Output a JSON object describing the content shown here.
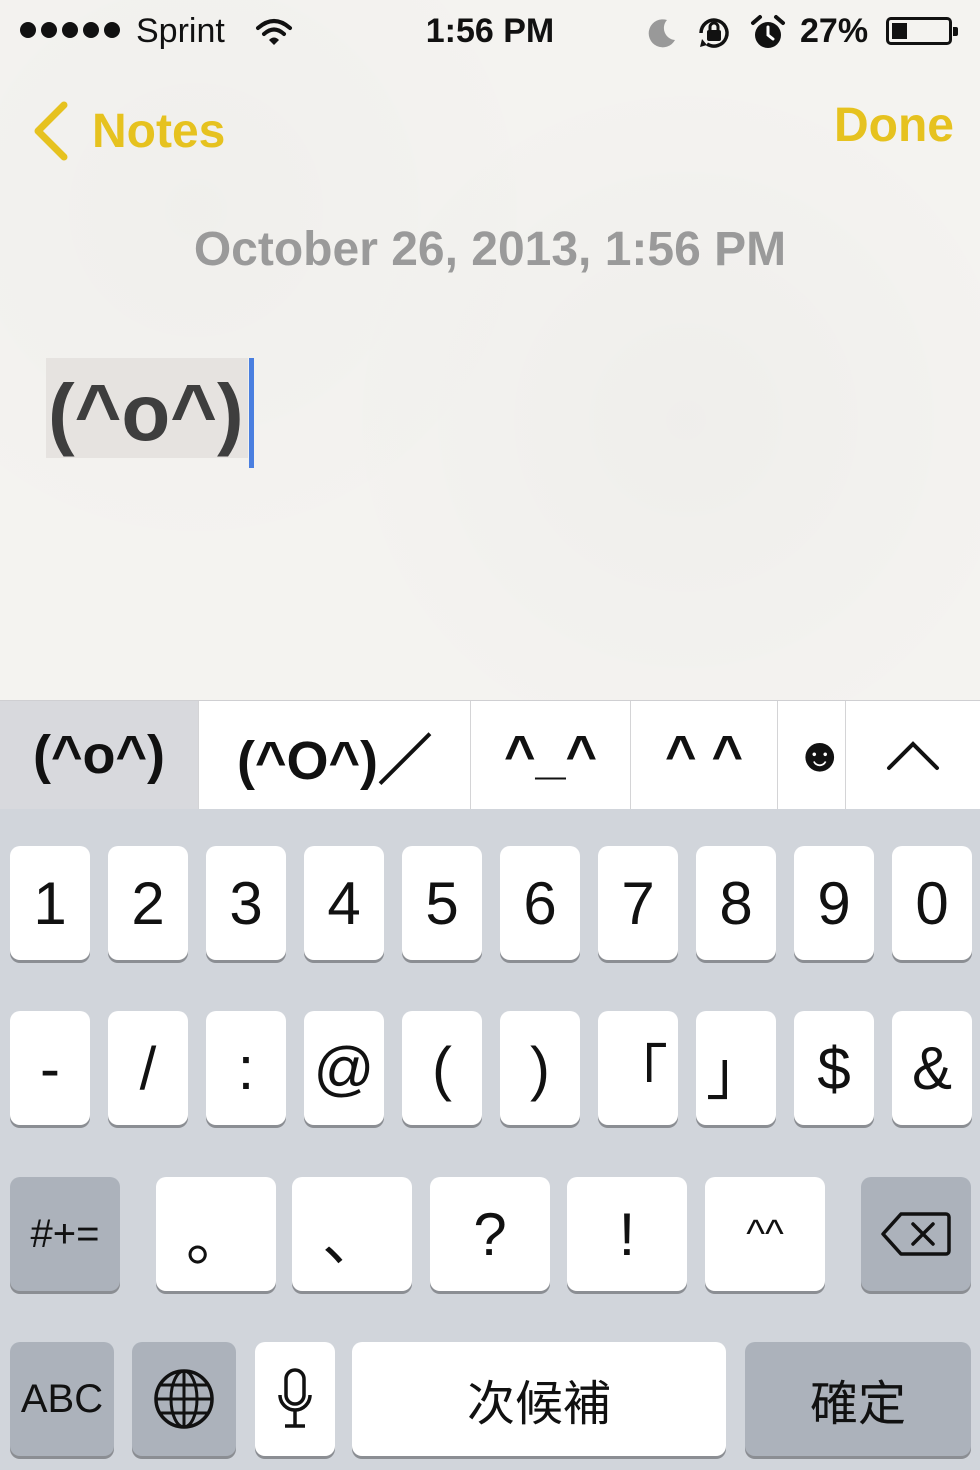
{
  "status_bar": {
    "carrier": "Sprint",
    "time": "1:56 PM",
    "battery_percent": "27%",
    "battery_level": 0.27,
    "icons": [
      "signal-dots-icon",
      "wifi-icon",
      "moon-icon",
      "rotation-lock-icon",
      "alarm-icon",
      "battery-icon"
    ]
  },
  "nav": {
    "back_label": "Notes",
    "done_label": "Done",
    "accent_color": "#e6c21f"
  },
  "note": {
    "date": "October 26, 2013, 1:56 PM",
    "text": "(^o^)"
  },
  "candidates": {
    "items": [
      "(^o^)",
      "(^O^)／",
      "^_^",
      "^ ^",
      "☻"
    ],
    "selected_index": 0
  },
  "keyboard": {
    "row1": [
      "1",
      "2",
      "3",
      "4",
      "5",
      "6",
      "7",
      "8",
      "9",
      "0"
    ],
    "row2": [
      "-",
      "/",
      ":",
      "@",
      "(",
      ")",
      "「",
      "」",
      "$",
      "&"
    ],
    "row3_mode": "#+=",
    "row3": [
      "。",
      "、",
      "?",
      "!",
      "^^"
    ],
    "abc": "ABC",
    "next_candidate": "次候補",
    "confirm": "確定"
  }
}
